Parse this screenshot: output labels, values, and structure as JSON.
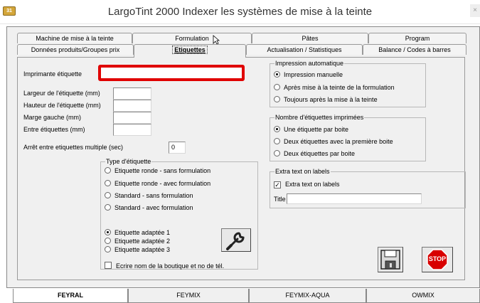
{
  "window": {
    "title": "LargoTint 2000 Indexer les systèmes de mise à la teinte",
    "icon": "app-icon",
    "close_glyph": "×"
  },
  "tabs": {
    "row1": [
      {
        "label": "Machine de mise à la teinte"
      },
      {
        "label": "Formulation"
      },
      {
        "label": "Pâtes"
      },
      {
        "label": "Program"
      }
    ],
    "row2": [
      {
        "label": "Données produits/Groupes prix"
      },
      {
        "label": "Etiquettes",
        "active": true
      },
      {
        "label": "Actualisation / Statistiques"
      },
      {
        "label": "Balance / Codes à barres"
      }
    ]
  },
  "form": {
    "printer_label": "Imprimante étiquette",
    "printer_value": "",
    "width_label": "Largeur de l'étiquette (mm)",
    "height_label": "Hauteur de l'étiquette (mm)",
    "margin_label": "Marge gauche (mm)",
    "between_label": "Entre étiquettes (mm)",
    "width_value": "",
    "height_value": "",
    "margin_value": "",
    "between_value": "",
    "pause_label": "Arrêt entre etiquettes multiple (sec)",
    "pause_value": "0"
  },
  "label_type": {
    "title": "Type d'étiquette",
    "options": [
      "Etiquette ronde - sans formulation",
      "Etiquette ronde - avec formulation",
      "Standard - sans formulation",
      "Standard - avec formulation"
    ],
    "adapted": [
      "Etiquette adaptée 1",
      "Etiquette adaptée 2",
      "Etiquette adaptée 3"
    ],
    "selected_adapted": 0,
    "shop_name_checkbox": "Ecrire nom de la boutique et no de tél.",
    "wrench_icon": "wrench-icon"
  },
  "auto_print": {
    "title": "Impression automatique",
    "options": [
      "Impression manuelle",
      "Après mise à la teinte de la formulation",
      "Toujours après la mise à la teinte"
    ],
    "selected": 0
  },
  "label_count": {
    "title": "Nombre d'étiquettes imprimées",
    "options": [
      "Une étiquette par boite",
      "Deux étiquettes avec la première boite",
      "Deux étiquettes par boite"
    ],
    "selected": 0
  },
  "extra_text": {
    "title": "Extra text on labels",
    "checkbox": "Extra text on labels",
    "checked": true,
    "field_label": "Title",
    "field_value": ""
  },
  "buttons": {
    "save_icon": "floppy-disk-icon",
    "stop_label": "STOP"
  },
  "bottom_tabs": [
    "FEYRAL",
    "FEYMIX",
    "FEYMIX-AQUA",
    "OWMIX"
  ],
  "colors": {
    "highlight": "#e00000",
    "stop_red": "#d80000"
  }
}
